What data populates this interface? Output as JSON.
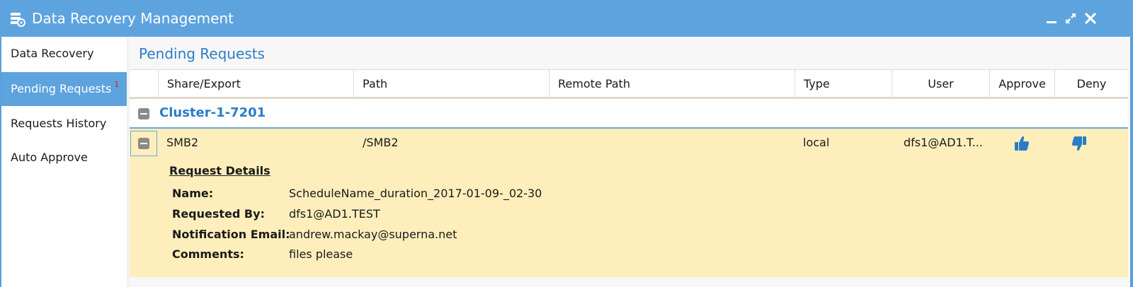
{
  "window": {
    "title": "Data Recovery Management"
  },
  "sidebar": {
    "items": [
      {
        "label": "Data Recovery"
      },
      {
        "label": "Pending Requests",
        "badge": "1"
      },
      {
        "label": "Requests History"
      },
      {
        "label": "Auto Approve"
      }
    ]
  },
  "main": {
    "title": "Pending Requests",
    "columns": [
      "Share/Export",
      "Path",
      "Remote Path",
      "Type",
      "User",
      "Approve",
      "Deny"
    ],
    "group": {
      "label": "Cluster-1-7201"
    },
    "row": {
      "share": "SMB2",
      "path": "/SMB2",
      "remote_path": "",
      "type": "local",
      "user": "dfs1@AD1.T..."
    },
    "details": {
      "title": "Request Details",
      "fields": [
        {
          "label": "Name:",
          "value": "ScheduleName_duration_2017-01-09-_02-30"
        },
        {
          "label": "Requested By:",
          "value": "dfs1@AD1.TEST"
        },
        {
          "label": "Notification Email:",
          "value": "andrew.mackay@superna.net"
        },
        {
          "label": "Comments:",
          "value": "files please"
        }
      ]
    }
  },
  "colors": {
    "titlebar": "#5da3de",
    "accent": "#2b7cc7",
    "row_highlight": "#fdeebb",
    "badge": "#e0201c"
  }
}
